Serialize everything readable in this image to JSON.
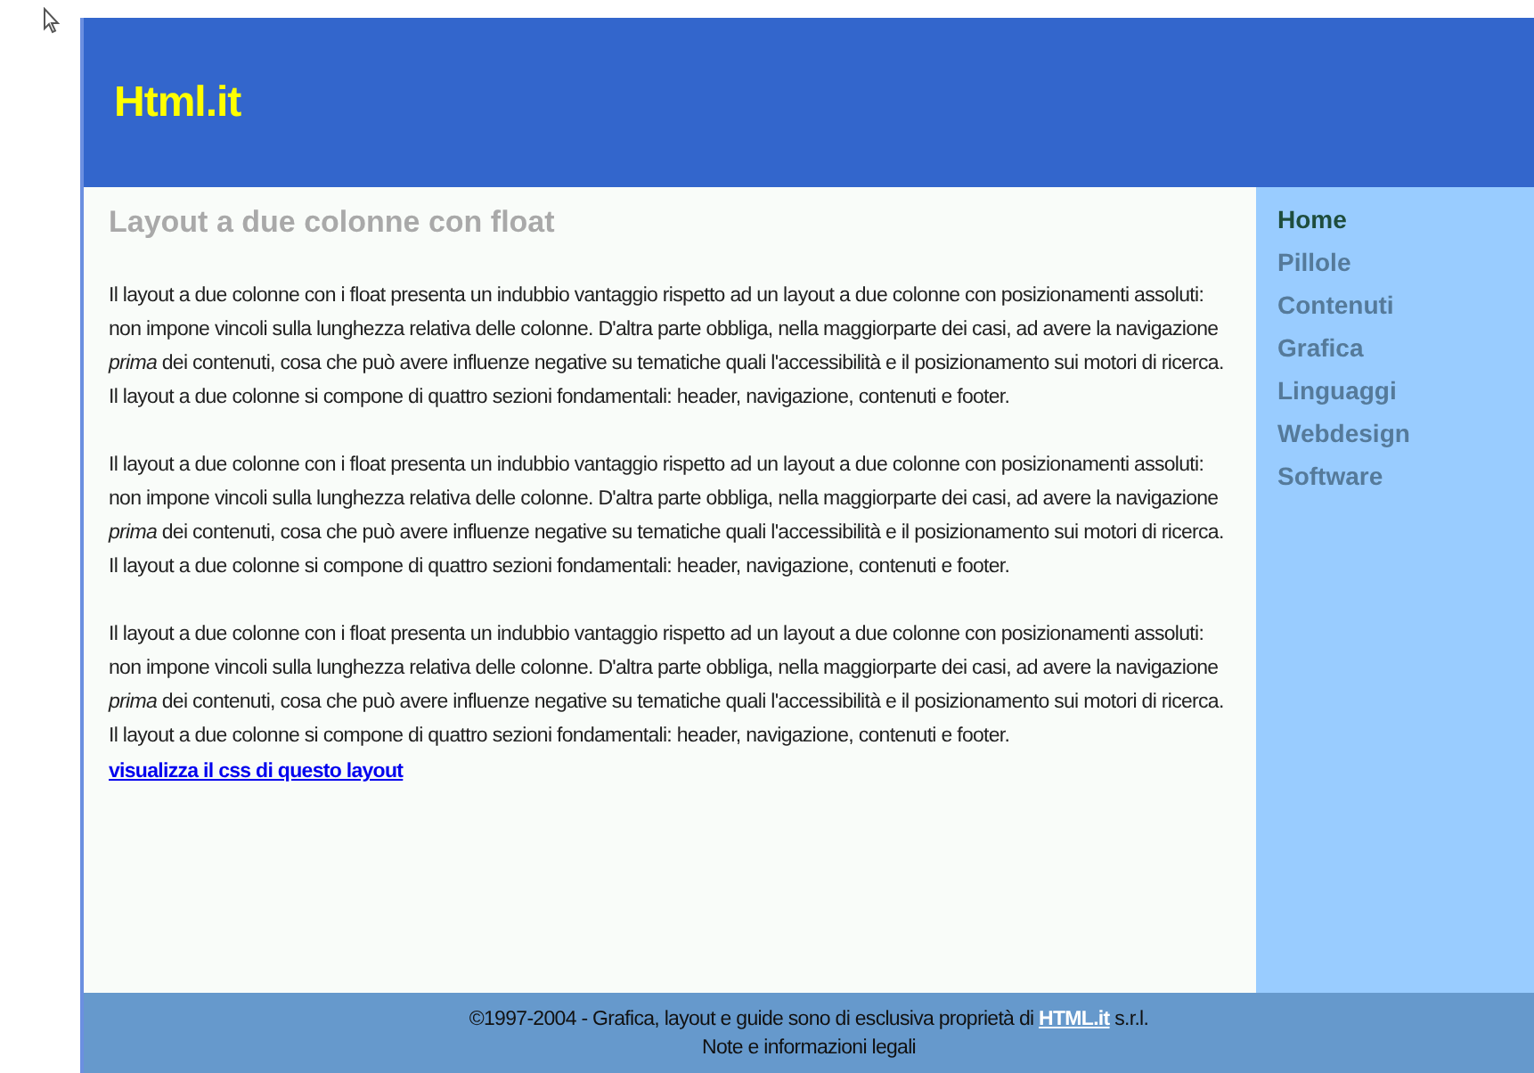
{
  "header": {
    "logo": "Html.it"
  },
  "content": {
    "title": "Layout a due colonne con float",
    "paragraphs": [
      "Il layout a due colonne con i float presenta un indubbio vantaggio rispetto ad un layout a due colonne con posizionamenti assoluti: non impone vincoli sulla lunghezza relativa delle colonne. D'altra parte obbliga, nella maggiorparte dei casi, ad avere la navigazione *prima* dei contenuti, cosa che può avere influenze negative su tematiche quali l'accessibilità e il posizionamento sui motori di ricerca. Il layout a due colonne si compone di quattro sezioni fondamentali: header, navigazione, contenuti e footer.",
      "Il layout a due colonne con i float presenta un indubbio vantaggio rispetto ad un layout a due colonne con posizionamenti assoluti: non impone vincoli sulla lunghezza relativa delle colonne. D'altra parte obbliga, nella maggiorparte dei casi, ad avere la navigazione *prima* dei contenuti, cosa che può avere influenze negative su tematiche quali l'accessibilità e il posizionamento sui motori di ricerca. Il layout a due colonne si compone di quattro sezioni fondamentali: header, navigazione, contenuti e footer.",
      "Il layout a due colonne con i float presenta un indubbio vantaggio rispetto ad un layout a due colonne con posizionamenti assoluti: non impone vincoli sulla lunghezza relativa delle colonne. D'altra parte obbliga, nella maggiorparte dei casi, ad avere la navigazione *prima* dei contenuti, cosa che può avere influenze negative su tematiche quali l'accessibilità e il posizionamento sui motori di ricerca. Il layout a due colonne si compone di quattro sezioni fondamentali: header, navigazione, contenuti e footer."
    ],
    "link": "visualizza il css di questo layout"
  },
  "nav": {
    "items": [
      {
        "label": "Home",
        "selected": true
      },
      {
        "label": "Pillole",
        "selected": false
      },
      {
        "label": "Contenuti",
        "selected": false
      },
      {
        "label": "Grafica",
        "selected": false
      },
      {
        "label": "Linguaggi",
        "selected": false
      },
      {
        "label": "Webdesign",
        "selected": false
      },
      {
        "label": "Software",
        "selected": false
      }
    ]
  },
  "footer": {
    "copyright_before": "©1997-2004 - Grafica, layout e guide sono di esclusiva proprietà di",
    "copyright_link": "HTML.it",
    "copyright_after": "s.r.l.",
    "legal": "Note e informazioni legali"
  }
}
